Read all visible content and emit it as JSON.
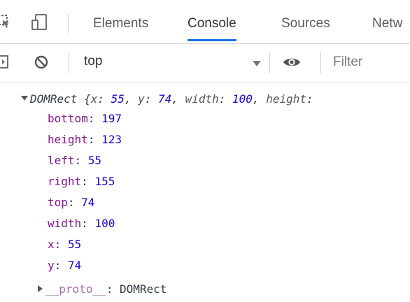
{
  "tabs": [
    {
      "label": "Elements"
    },
    {
      "label": "Console"
    },
    {
      "label": "Sources"
    },
    {
      "label": "Netw"
    }
  ],
  "toolbar": {
    "context": "top",
    "filter_placeholder": "Filter"
  },
  "console": {
    "object_name": "DOMRect",
    "preview": {
      "x_key": "x",
      "x_val": "55",
      "y_key": "y",
      "y_val": "74",
      "width_key": "width",
      "width_val": "100",
      "height_key": "height"
    },
    "properties": [
      {
        "key": "bottom",
        "value": "197"
      },
      {
        "key": "height",
        "value": "123"
      },
      {
        "key": "left",
        "value": "55"
      },
      {
        "key": "right",
        "value": "155"
      },
      {
        "key": "top",
        "value": "74"
      },
      {
        "key": "width",
        "value": "100"
      },
      {
        "key": "x",
        "value": "55"
      },
      {
        "key": "y",
        "value": "74"
      }
    ],
    "proto": {
      "key": "__proto__",
      "value": "DOMRect"
    }
  },
  "colors": {
    "active_tab_underline": "#1a73e8",
    "property_key": "#881391",
    "number_value": "#1c00cf"
  },
  "icons": [
    "inspect-element-icon",
    "device-toggle-icon",
    "sidebar-toggle-icon",
    "clear-console-icon",
    "dropdown-arrow-icon",
    "eye-icon"
  ]
}
